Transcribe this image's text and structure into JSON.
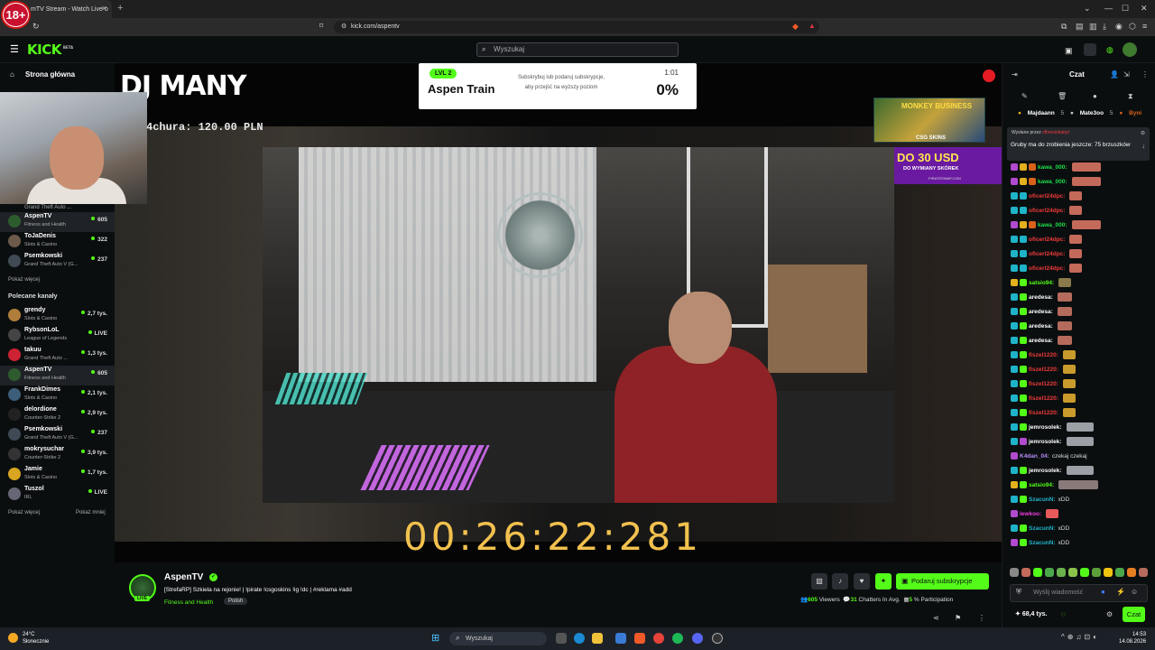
{
  "browser": {
    "tab_title": "mTV Stream - Watch Live o",
    "url": "kick.com/aspentv",
    "age_badge": "18+"
  },
  "header": {
    "logo": "KICK",
    "logo_beta": "BETA",
    "search_placeholder": "Wyszukaj"
  },
  "sidebar": {
    "home": "Strona główna",
    "followed": [
      {
        "name": "AspenTV",
        "game": "Fitness and Health",
        "viewers": "605",
        "avatar_color": "#2e5b2e"
      },
      {
        "name": "ToJaDenis",
        "game": "Slots & Casino",
        "viewers": "322",
        "avatar_color": "#6d5a4a"
      },
      {
        "name": "Psemkowski",
        "game": "Grand Theft Auto V (G...",
        "viewers": "237",
        "avatar_color": "#404a55"
      }
    ],
    "partial_game": "Grand Theft Auto ...",
    "show_more": "Pokaż więcej",
    "recommended_header": "Polecane kanały",
    "recommended": [
      {
        "name": "grendy",
        "game": "Slots & Casino",
        "viewers": "2,7 tys.",
        "avatar_color": "#b07d3a"
      },
      {
        "name": "RybsonLoL",
        "game": "League of Legends",
        "viewers": "LIVE",
        "avatar_color": "#444"
      },
      {
        "name": "takuu",
        "game": "Grand Theft Auto ...",
        "viewers": "1,3 tys.",
        "avatar_color": "#c23"
      },
      {
        "name": "AspenTV",
        "game": "Fitness and Health",
        "viewers": "605",
        "avatar_color": "#2e5b2e"
      },
      {
        "name": "FrankDimes",
        "game": "Slots & Casino",
        "viewers": "2,1 tys.",
        "avatar_color": "#3c5e7a"
      },
      {
        "name": "delordione",
        "game": "Counter-Strike 2",
        "viewers": "2,9 tys.",
        "avatar_color": "#222"
      },
      {
        "name": "Psemkowski",
        "game": "Grand Theft Auto V (G...",
        "viewers": "237",
        "avatar_color": "#404a55"
      },
      {
        "name": "mokrysuchar",
        "game": "Counter-Strike 2",
        "viewers": "3,9 tys.",
        "avatar_color": "#333"
      },
      {
        "name": "Jamie",
        "game": "Slots & Casino",
        "viewers": "1,7 tys.",
        "avatar_color": "#d9a520"
      },
      {
        "name": "Tuszol",
        "game": "IRL",
        "viewers": "LIVE",
        "avatar_color": "#667"
      }
    ],
    "show_more2": "Pokaż więcej",
    "show_less": "Pokaż mniej"
  },
  "stream": {
    "overlay_title": "DJ MANY",
    "donor": "4chura: 120.00 PLN",
    "timer": "00:26:22:281",
    "goal": {
      "level": "LVL 2",
      "name": "Aspen Train",
      "text": "Subskrybuj lub podaruj subskrypcje, aby przejść na wyższy poziom",
      "time": "1:01",
      "percent": "0%"
    },
    "ad1_title": "MONKEY BUSINESS",
    "ad1_brand": "CSG SKINS",
    "ad2_title": "DO 30 USD",
    "ad2_sub": "DO WYMIANY SKÓREK",
    "ad2_url": "PIRATESWAP.COM"
  },
  "info": {
    "channel": "AspenTV",
    "live": "LIVE",
    "title": "[StrefaRP] Szkiela na rejonie! | !pirate !csgoskins !ig !dc | #reklama #add",
    "category": "Fitness and Health",
    "language": "Polish",
    "subscribe_label": "Podaruj subskrypcje",
    "viewers": "605",
    "viewers_label": "Viewers",
    "chatters": "31",
    "chatters_label": "Chatters In Avg.",
    "participation": "5",
    "participation_label": "% Participation"
  },
  "chat": {
    "title": "Czat",
    "leaders": [
      {
        "name": "Majdaann",
        "count": "5"
      },
      {
        "name": "Mate3oo",
        "count": "5"
      },
      {
        "name": "Byni",
        "count": ""
      }
    ],
    "pinned_by_label": "Wysłane przez",
    "pinned_by": "sfbrexinbabyt",
    "pinned_text": "Gruby ma do zrobienia jeszcze: 75 brzuszków",
    "messages": [
      {
        "user": "kawa_000:",
        "color": "#1fe04a",
        "text": ""
      },
      {
        "user": "kawa_000:",
        "color": "#1fe04a",
        "text": ""
      },
      {
        "user": "oficerl24dpc:",
        "color": "#f03a3a",
        "text": ""
      },
      {
        "user": "oficerl24dpc:",
        "color": "#f03a3a",
        "text": ""
      },
      {
        "user": "kawa_000:",
        "color": "#1fe04a",
        "text": ""
      },
      {
        "user": "oficerl24dpc:",
        "color": "#f03a3a",
        "text": ""
      },
      {
        "user": "oficerl24dpc:",
        "color": "#f03a3a",
        "text": ""
      },
      {
        "user": "oficerl24dpc:",
        "color": "#f03a3a",
        "text": ""
      },
      {
        "user": "satsio94:",
        "color": "#53fc18",
        "text": ""
      },
      {
        "user": "aredesa:",
        "color": "#ffffff",
        "text": ""
      },
      {
        "user": "aredesa:",
        "color": "#ffffff",
        "text": ""
      },
      {
        "user": "aredesa:",
        "color": "#ffffff",
        "text": ""
      },
      {
        "user": "aredesa:",
        "color": "#ffffff",
        "text": ""
      },
      {
        "user": "fiszel1220:",
        "color": "#f03a3a",
        "text": ""
      },
      {
        "user": "fiszel1220:",
        "color": "#f03a3a",
        "text": ""
      },
      {
        "user": "fiszel1220:",
        "color": "#f03a3a",
        "text": ""
      },
      {
        "user": "fiszel1220:",
        "color": "#f03a3a",
        "text": ""
      },
      {
        "user": "fiszel1220:",
        "color": "#f03a3a",
        "text": ""
      },
      {
        "user": "jemrosolek:",
        "color": "#ffffff",
        "text": ""
      },
      {
        "user": "jemrosolek:",
        "color": "#ffffff",
        "text": ""
      },
      {
        "user": "K4dan_04:",
        "color": "#b28cf5",
        "text": "czekaj czekaj"
      },
      {
        "user": "jemrosolek:",
        "color": "#ffffff",
        "text": ""
      },
      {
        "user": "satsio94:",
        "color": "#53fc18",
        "text": ""
      },
      {
        "user": "SzacunN:",
        "color": "#1fb3c9",
        "text": "xDD"
      },
      {
        "user": "lewkoo:",
        "color": "#f03ae0",
        "text": ""
      },
      {
        "user": "SzacunN:",
        "color": "#1fb3c9",
        "text": "xDD"
      },
      {
        "user": "SzacunN:",
        "color": "#1fb3c9",
        "text": "xDD"
      }
    ],
    "input_placeholder": "Wyślij wiadomość",
    "kicks": "68,4 tys.",
    "send_label": "Czat"
  },
  "taskbar": {
    "temp": "24°C",
    "weather": "Słonecznie",
    "search": "Wyszukaj",
    "time": "14:53",
    "date": "14.08.2026"
  }
}
